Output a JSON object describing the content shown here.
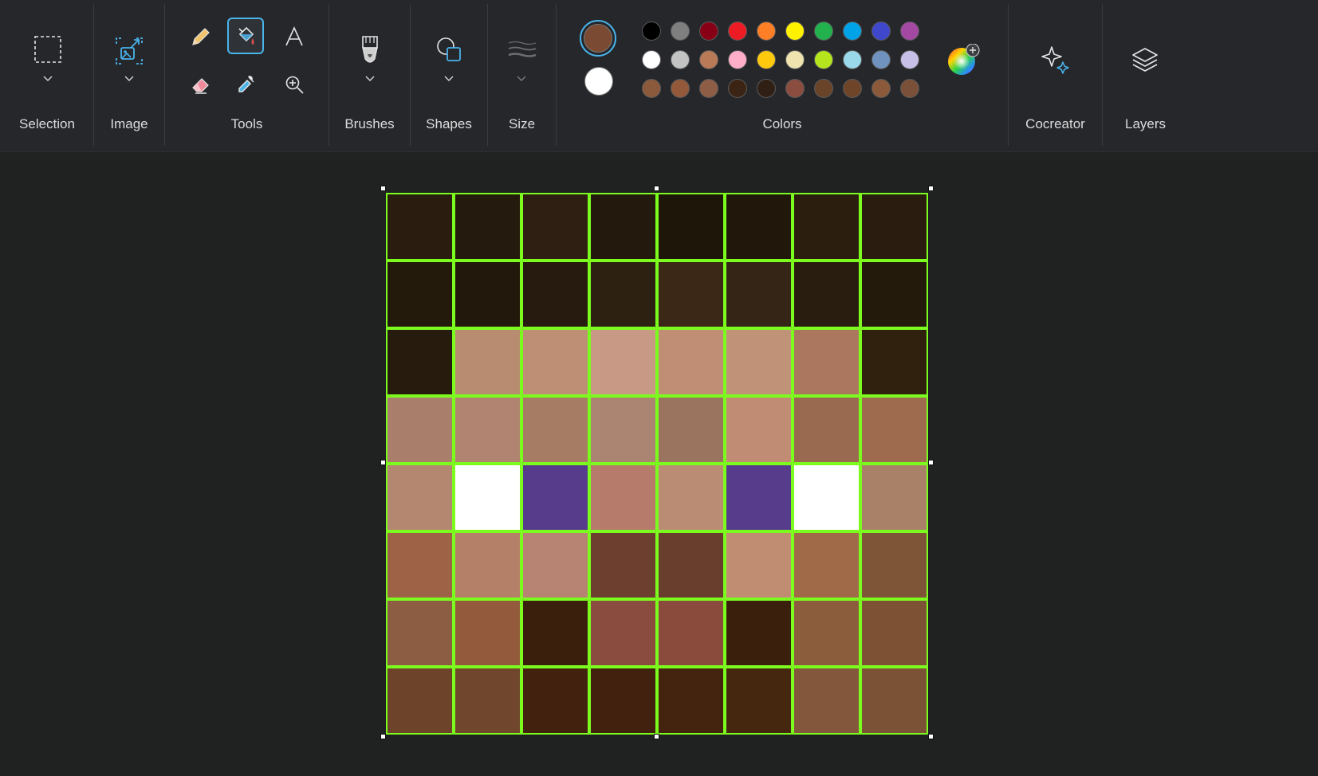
{
  "toolbar": {
    "selection_label": "Selection",
    "image_label": "Image",
    "tools_label": "Tools",
    "brushes_label": "Brushes",
    "shapes_label": "Shapes",
    "size_label": "Size",
    "colors_label": "Colors",
    "cocreator_label": "Cocreator",
    "layers_label": "Layers",
    "tools": [
      {
        "name": "pencil",
        "icon": "pencil-icon"
      },
      {
        "name": "fill",
        "icon": "fill-bucket-icon",
        "selected": true
      },
      {
        "name": "text",
        "icon": "text-icon"
      },
      {
        "name": "eraser",
        "icon": "eraser-icon"
      },
      {
        "name": "color-picker",
        "icon": "eyedropper-icon"
      },
      {
        "name": "magnifier",
        "icon": "magnifier-icon"
      }
    ]
  },
  "colors": {
    "primary": "#7a4a32",
    "secondary": "#ffffff",
    "palette": [
      [
        "#000000",
        "#7f7f7f",
        "#880015",
        "#ed1c24",
        "#ff7f27",
        "#fff200",
        "#22b14c",
        "#00a2e8",
        "#3f48cc",
        "#a349a4"
      ],
      [
        "#ffffff",
        "#c3c3c3",
        "#b97a57",
        "#ffaec9",
        "#ffc90e",
        "#efe4b0",
        "#b5e61d",
        "#99d9ea",
        "#7092be",
        "#c8bfe7"
      ],
      [
        "#8b5a3c",
        "#93593a",
        "#8e5d45",
        "#3b2413",
        "#2f1f14",
        "#8a4d40",
        "#6a4428",
        "#6e4529",
        "#8a5a3b",
        "#7a5038"
      ]
    ]
  },
  "canvas": {
    "grid_color": "#7cfc1e",
    "pixels": [
      [
        "#2a1d10",
        "#241a0d",
        "#2e1f12",
        "#23190c",
        "#1f160a",
        "#21180b",
        "#2b1e0f",
        "#2a1c0e"
      ],
      [
        "#241a0c",
        "#22180b",
        "#261b0e",
        "#2d2112",
        "#3c2816",
        "#342516",
        "#291d0f",
        "#241a0c"
      ],
      [
        "#271b0d",
        "#b88c70",
        "#bf8f75",
        "#c89a85",
        "#c08e74",
        "#c09278",
        "#ab775e",
        "#30210f"
      ],
      [
        "#a97e6a",
        "#b08470",
        "#a77c65",
        "#ac8472",
        "#9b745f",
        "#c08c74",
        "#996a4f",
        "#9f6b4e"
      ],
      [
        "#b48771",
        "#ffffff",
        "#563c8a",
        "#b67b6b",
        "#bb8c74",
        "#563c8a",
        "#ffffff",
        "#a98068"
      ],
      [
        "#9e6346",
        "#b58068",
        "#b78373",
        "#6d3f2f",
        "#6a3e2d",
        "#c08c72",
        "#a06a48",
        "#7f5537"
      ],
      [
        "#8c5d43",
        "#935b3b",
        "#3b1f0d",
        "#8a4c3e",
        "#8a4b3c",
        "#3a1f0d",
        "#8c5d3c",
        "#7c5134"
      ],
      [
        "#6d4429",
        "#70462c",
        "#42220e",
        "#42210e",
        "#44240f",
        "#45270f",
        "#83573c",
        "#7b5236"
      ]
    ]
  }
}
